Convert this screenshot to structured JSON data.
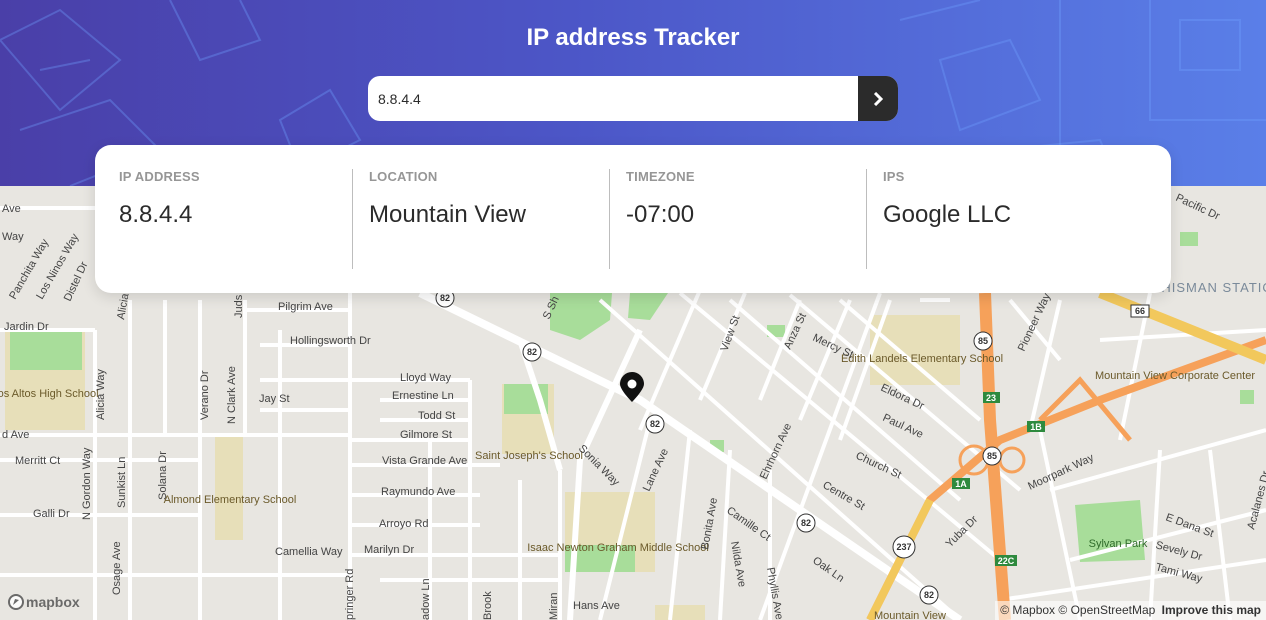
{
  "header": {
    "title": "IP address Tracker",
    "search_value": "8.8.4.4",
    "submit_icon": "chevron-right-icon",
    "gradient": [
      "#4a3fa8",
      "#5a7fe8"
    ]
  },
  "info": [
    {
      "label": "IP ADDRESS",
      "value": "8.8.4.4"
    },
    {
      "label": "LOCATION",
      "value": "Mountain View"
    },
    {
      "label": "TIMEZONE",
      "value": "-07:00"
    },
    {
      "label": "IPS",
      "value": "Google LLC"
    }
  ],
  "map": {
    "marker_icon": "location-pin-icon",
    "road_colors": {
      "highway": "#f6a15a",
      "freeway": "#f2c85c",
      "street": "#ffffff",
      "park": "#a8dd9a",
      "school": "#e7dfb9"
    },
    "places": {
      "los_altos_high_school": "Los Altos High School",
      "almond_elementary_school": "Almond Elementary School",
      "saint_josephs_school": "Saint Joseph's School",
      "isaac_newton_graham_middle_school": "Isaac Newton Graham Middle School",
      "edith_landels_elementary_school": "Edith Landels Elementary School",
      "mountain_view_corporate_center": "Mountain View Corporate Center",
      "whisman_station": "WHISMAN STATION",
      "sylvan_park": "Sylvan Park",
      "mountain_view": "Mountain View"
    },
    "streets": {
      "ave": "Ave",
      "way": "Way",
      "panchita_way": "Panchita Way",
      "los_ninos_way": "Los Ninos Way",
      "distel_dr": "Distel Dr",
      "jardin_dr": "Jardin Dr",
      "alicia": "Alicia",
      "juds": "Juds",
      "pilgrim_ave": "Pilgrim Ave",
      "hollingsworth_dr": "Hollingsworth Dr",
      "alicia_way": "Alicia Way",
      "verano_dr": "Verano Dr",
      "n_clark_ave": "N Clark Ave",
      "jay_st": "Jay St",
      "d_ave": "d Ave",
      "lloyd_way": "Lloyd Way",
      "ernestine_ln": "Ernestine Ln",
      "todd_st": "Todd St",
      "gilmore_st": "Gilmore St",
      "vista_grande_ave": "Vista Grande Ave",
      "merritt_ct": "Merritt Ct",
      "n_gordon_way": "N Gordon Way",
      "sunkist_ln": "Sunkist Ln",
      "solana_dr": "Solana Dr",
      "raymundo_ave": "Raymundo Ave",
      "galli_dr": "Galli Dr",
      "arroyo_rd": "Arroyo Rd",
      "camellia_way": "Camellia Way",
      "marilyn_dr": "Marilyn Dr",
      "osage_ave": "Osage Ave",
      "springer_rd": "pringer Rd",
      "adow_ln": "adow Ln",
      "brook": "Brook",
      "miran": "Miran",
      "hans_ave": "Hans Ave",
      "s_sh": "S Sh",
      "view_st": "View St",
      "anza_st": "Anza St",
      "mercy_st": "Mercy St",
      "pioneer_way": "Pioneer Way",
      "pacific_dr": "Pacific Dr",
      "eldora_dr": "Eldora Dr",
      "paul_ave": "Paul Ave",
      "ehrhorn_ave": "Ehrhorn Ave",
      "church_st": "Church St",
      "sonia_way": "Sonia Way",
      "lane_ave": "Lane Ave",
      "centre_st": "Centre St",
      "bonita_ave": "Bonita Ave",
      "camille_ct": "Camille Ct",
      "nilda_ave": "Nilda Ave",
      "phyllis_ave": "Phyllis Ave",
      "oak_ln": "Oak Ln",
      "yuba_dr": "Yuba Dr",
      "moorpark_way": "Moorpark Way",
      "e_dana_st": "E Dana St",
      "sevely_dr": "Sevely Dr",
      "tami_way": "Tami Way",
      "acalanes_dr": "Acalanes Dr"
    },
    "route_shields": {
      "r82": "82",
      "r85": "85",
      "r237": "237",
      "r66": "66",
      "r23": "23",
      "r1b": "1B",
      "r1a": "1A",
      "r22c": "22C"
    }
  },
  "footer": {
    "logo": "mapbox",
    "attribution_mapbox": "© Mapbox",
    "attribution_osm": "© OpenStreetMap",
    "improve": "Improve this map"
  }
}
